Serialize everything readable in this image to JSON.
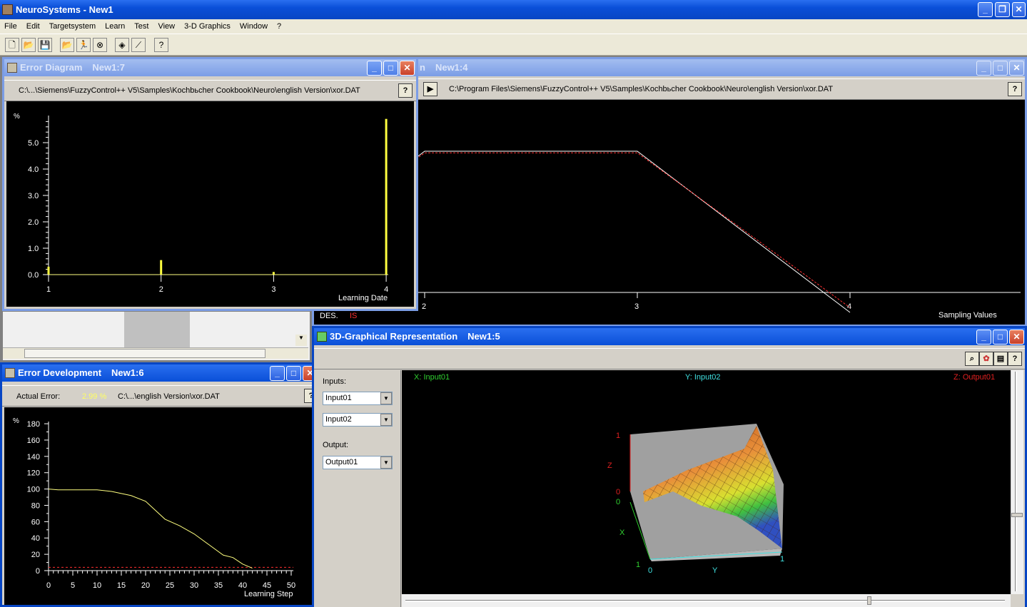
{
  "app": {
    "title": "NeuroSystems - New1"
  },
  "menu": [
    "File",
    "Edit",
    "Targetsystem",
    "Learn",
    "Test",
    "View",
    "3-D Graphics",
    "Window",
    "?"
  ],
  "toolbar": [
    "new-icon",
    "open-icon",
    "save-icon",
    "open-data-icon",
    "run-learn-icon",
    "stop-icon",
    "3d-graphics-icon",
    "diagram-icon",
    "help-icon"
  ],
  "sampling_window": {
    "title_prefix": "n",
    "number": "New1:4",
    "path": "C:\\Program Files\\Siemens\\FuzzyControl++ V5\\Samples\\Kochbьcher Cookbook\\Neuro\\english Version\\xor.DAT",
    "legend_des": "DES.",
    "legend_is": "IS",
    "xlabel": "Sampling Values",
    "xticks": [
      "2",
      "3",
      "4"
    ],
    "chart_data": {
      "type": "line",
      "x": [
        1,
        2,
        3,
        4
      ],
      "series": [
        {
          "name": "DES.",
          "values": [
            0,
            1,
            1,
            0
          ]
        },
        {
          "name": "IS",
          "values": [
            0.02,
            0.99,
            0.99,
            0.03
          ]
        }
      ],
      "colors": {
        "DES.": "#ffffff",
        "IS": "#ff3030"
      }
    }
  },
  "error_diagram": {
    "title": "Error Diagram",
    "number": "New1:7",
    "path": "C:\\...\\Siemens\\FuzzyControl++ V5\\Samples\\Kochbьcher Cookbook\\Neuro\\english Version\\xor.DAT",
    "unit": "%",
    "xlabel": "Learning Date",
    "yticks": [
      "0.0",
      "1.0",
      "2.0",
      "3.0",
      "4.0",
      "5.0"
    ],
    "xticks": [
      "1",
      "2",
      "3",
      "4"
    ],
    "chart_data": {
      "type": "bar",
      "categories": [
        1,
        2,
        3,
        4
      ],
      "values": [
        0.3,
        0.55,
        0.1,
        5.9
      ],
      "ylim": [
        0,
        6
      ],
      "color": "#ffff40"
    }
  },
  "error_development": {
    "title": "Error Development",
    "number": "New1:6",
    "actual_label": "Actual Error:",
    "actual_value": "2.99 %",
    "path": "C:\\...\\english Version\\xor.DAT",
    "unit": "%",
    "xlabel": "Learning Step",
    "yticks": [
      "0",
      "20",
      "40",
      "60",
      "80",
      "100",
      "120",
      "140",
      "160",
      "180"
    ],
    "xticks": [
      "0",
      "5",
      "10",
      "15",
      "20",
      "25",
      "30",
      "35",
      "40",
      "45",
      "50"
    ],
    "chart_data": {
      "type": "line",
      "x": [
        0,
        2,
        5,
        10,
        13,
        17,
        20,
        24,
        27,
        30,
        33,
        36,
        38,
        40,
        42
      ],
      "values": [
        100,
        99,
        99,
        99,
        97,
        92,
        85,
        63,
        55,
        45,
        32,
        19,
        16,
        8,
        3
      ],
      "target": 4,
      "xlim": [
        0,
        50
      ],
      "ylim": [
        0,
        180
      ],
      "colors": {
        "line": "#ffff80",
        "target": "#ff3030"
      }
    }
  },
  "graph3d": {
    "title": "3D-Graphical Representation",
    "number": "New1:5",
    "inputs_label": "Inputs:",
    "input1": "Input01",
    "input2": "Input02",
    "output_label": "Output:",
    "output1": "Output01",
    "xaxis": "X: Input01",
    "yaxis": "Y: Input02",
    "zaxis": "Z: Output01",
    "z": "Z",
    "x": "X",
    "y": "Y",
    "z1": "1",
    "z0": "0",
    "x0": "0",
    "x1": "1",
    "y0": "0",
    "y1": "1",
    "tools": [
      "zoom-icon",
      "color-icon",
      "copy-icon",
      "help-icon"
    ]
  }
}
